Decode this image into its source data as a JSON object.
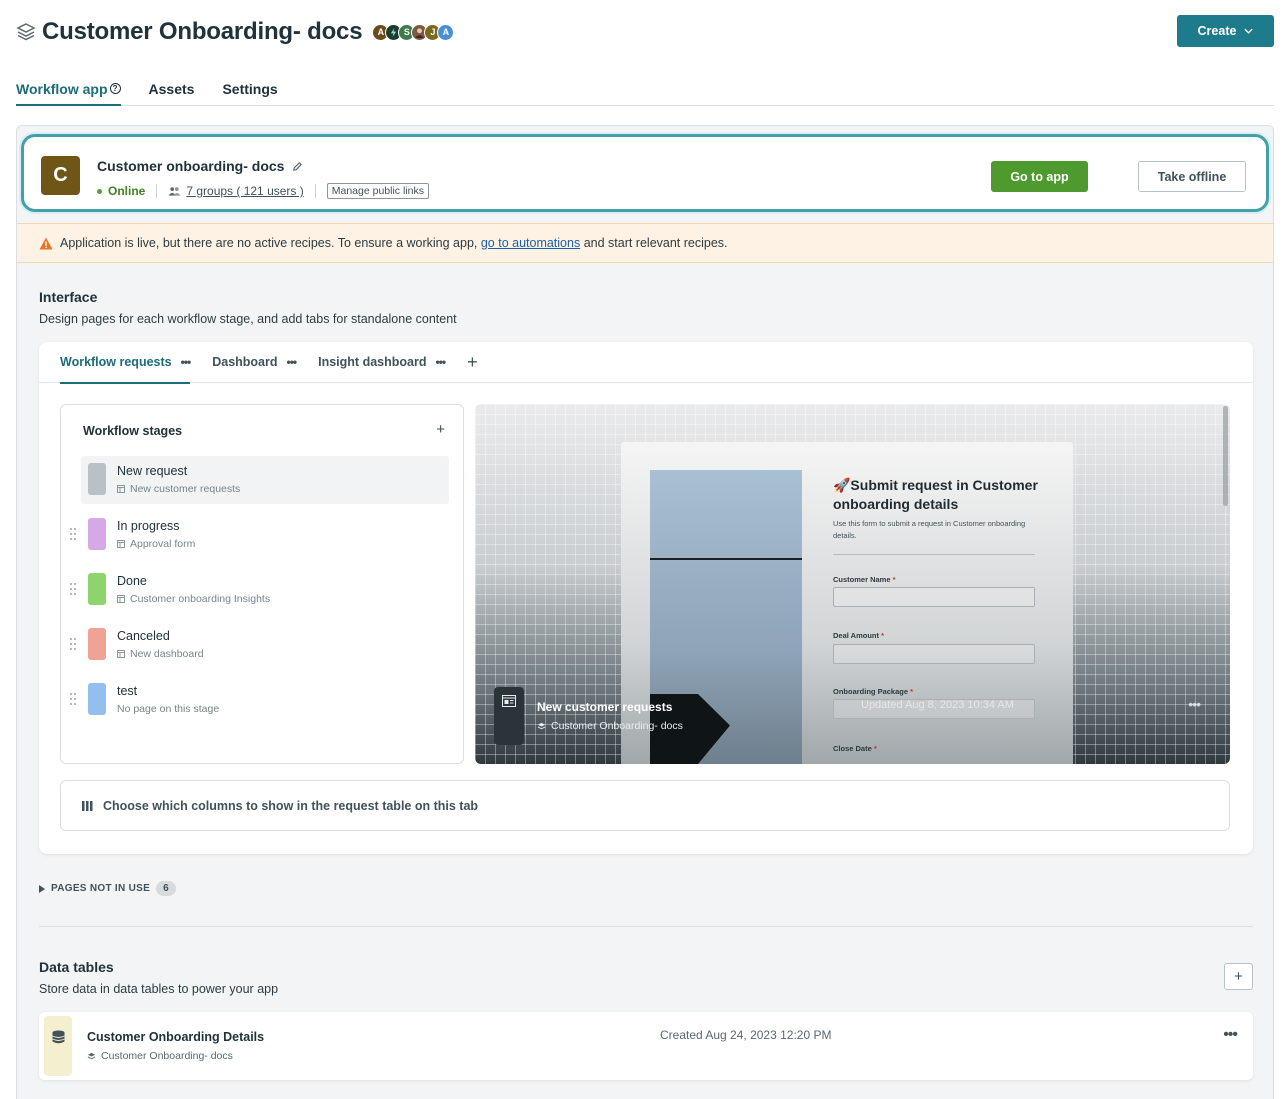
{
  "header": {
    "title": "Customer Onboarding- docs",
    "icon": "layers-icon",
    "avatars": [
      {
        "initial": "A",
        "color": "#6b4a1c"
      },
      {
        "initial": "",
        "color": "#1f3b2e"
      },
      {
        "initial": "S",
        "color": "#3f7a4c"
      },
      {
        "initial": "",
        "color": "#7a5a44"
      },
      {
        "initial": "J",
        "color": "#7b6a1a"
      },
      {
        "initial": "A",
        "color": "#4a8fd6"
      }
    ],
    "create_label": "Create"
  },
  "main_tabs": [
    {
      "label": "Workflow app"
    },
    {
      "label": "Assets"
    },
    {
      "label": "Settings"
    }
  ],
  "app": {
    "logo_letter": "C",
    "logo_color": "#6f5516",
    "name": "Customer onboarding- docs",
    "status": "Online",
    "groups_label": "7 groups ( 121 users )",
    "manage_links_label": "Manage public links",
    "go_to_app_label": "Go to app",
    "take_offline_label": "Take offline"
  },
  "warning": {
    "text_before": "Application is live, but there are no active recipes. To ensure a working app, ",
    "link": "go to automations",
    "text_after": " and start relevant recipes."
  },
  "interface": {
    "title": "Interface",
    "subtitle": "Design pages for each workflow stage, and add tabs for standalone content",
    "tabs": [
      {
        "label": "Workflow requests"
      },
      {
        "label": "Dashboard"
      },
      {
        "label": "Insight dashboard"
      }
    ],
    "stages_title": "Workflow stages",
    "stages": [
      {
        "name": "New request",
        "page": "New customer requests",
        "color": "#b9c0c6"
      },
      {
        "name": "In progress",
        "page": "Approval form",
        "color": "#d6a8e6"
      },
      {
        "name": "Done",
        "page": "Customer onboarding Insights",
        "color": "#8ed46e"
      },
      {
        "name": "Canceled",
        "page": "New dashboard",
        "color": "#f0a394"
      },
      {
        "name": "test",
        "page": "No page on this stage",
        "color": "#93bfef"
      }
    ],
    "preview": {
      "form_title": "🚀Submit request in Customer onboarding details",
      "form_desc": "Use this form to submit a request in Customer onboarding details.",
      "fields": [
        "Customer Name",
        "Deal Amount",
        "Onboarding Package",
        "Close Date"
      ],
      "page_name": "New customer requests",
      "app_name": "Customer Onboarding- docs",
      "updated": "Updated Aug 8, 2023 10:34 AM"
    },
    "columns_label": "Choose which columns to show in the request table on this tab"
  },
  "pages_not_in_use": {
    "label": "PAGES NOT IN USE",
    "count": "6"
  },
  "data_tables": {
    "title": "Data tables",
    "subtitle": "Store data in data tables to power your app",
    "items": [
      {
        "name": "Customer Onboarding Details",
        "app": "Customer Onboarding- docs",
        "created": "Created Aug 24, 2023 12:20 PM"
      }
    ]
  }
}
